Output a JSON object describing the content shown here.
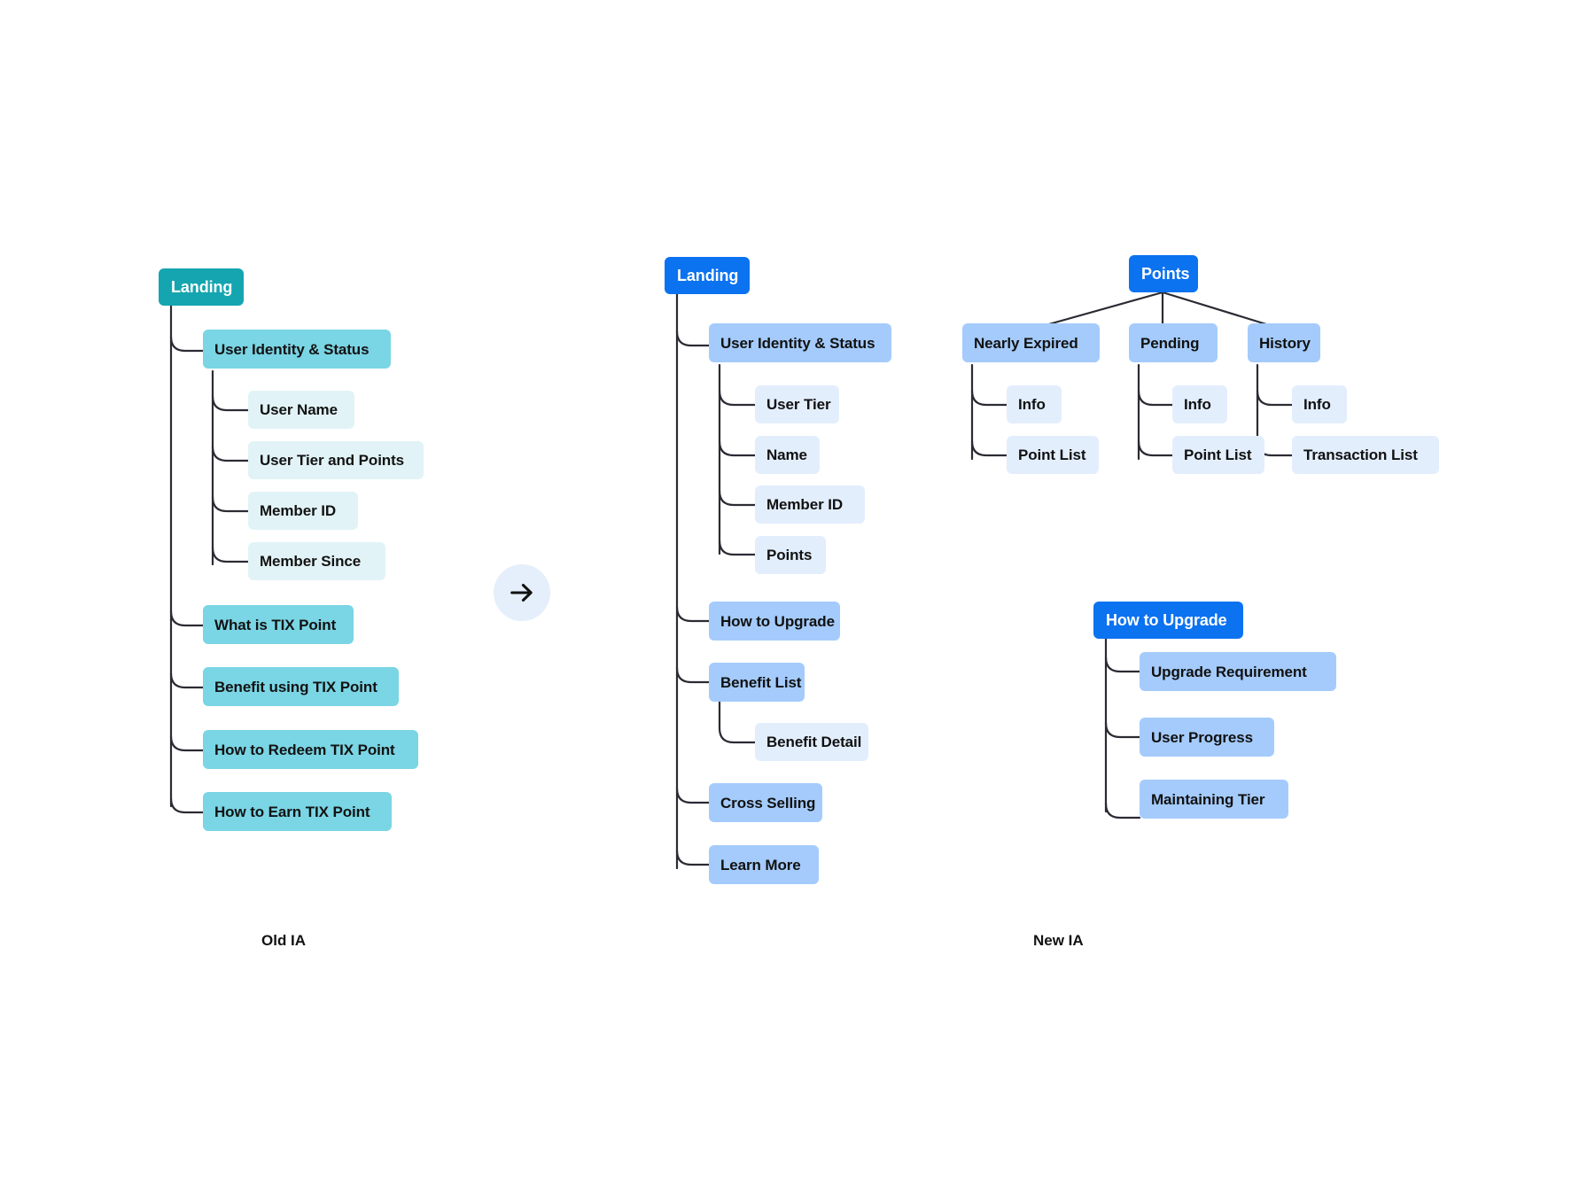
{
  "diagram": {
    "title_left": "Old IA",
    "title_right": "New IA",
    "arrow_icon": "arrow-right-icon",
    "colors": {
      "old_root": "#14A5B0",
      "old_level1": "#7AD5E4",
      "old_level2": "#E2F3F7",
      "new_root": "#0B72F0",
      "new_level1": "#A4CBFB",
      "new_level2": "#E3EEFD",
      "connector": "#2B2B34",
      "arrow_badge": "#E4EFFB",
      "background": "#FFFFFF"
    }
  },
  "old_ia": {
    "root": "Landing",
    "section": "User Identity & Status",
    "section_children": [
      "User Name",
      "User Tier and Points",
      "Member ID",
      "Member Since"
    ],
    "top_level": [
      "What is TIX Point",
      "Benefit using TIX Point",
      "How to Redeem TIX Point",
      "How to Earn TIX Point"
    ]
  },
  "new_ia": {
    "landing": {
      "root": "Landing",
      "section": "User Identity & Status",
      "section_children": [
        "User Tier",
        "Name",
        "Member ID",
        "Points"
      ],
      "top_level": [
        "How to Upgrade",
        "Benefit List",
        "Cross Selling",
        "Learn More"
      ],
      "benefit_child": "Benefit Detail"
    },
    "points": {
      "root": "Points",
      "branches": [
        {
          "label": "Nearly Expired",
          "children": [
            "Info",
            "Point List"
          ]
        },
        {
          "label": "Pending",
          "children": [
            "Info",
            "Point List"
          ]
        },
        {
          "label": "History",
          "children": [
            "Info",
            "Transaction List"
          ]
        }
      ]
    },
    "how_to_upgrade": {
      "root": "How to Upgrade",
      "children": [
        "Upgrade Requirement",
        "User Progress",
        "Maintaining Tier"
      ]
    }
  }
}
